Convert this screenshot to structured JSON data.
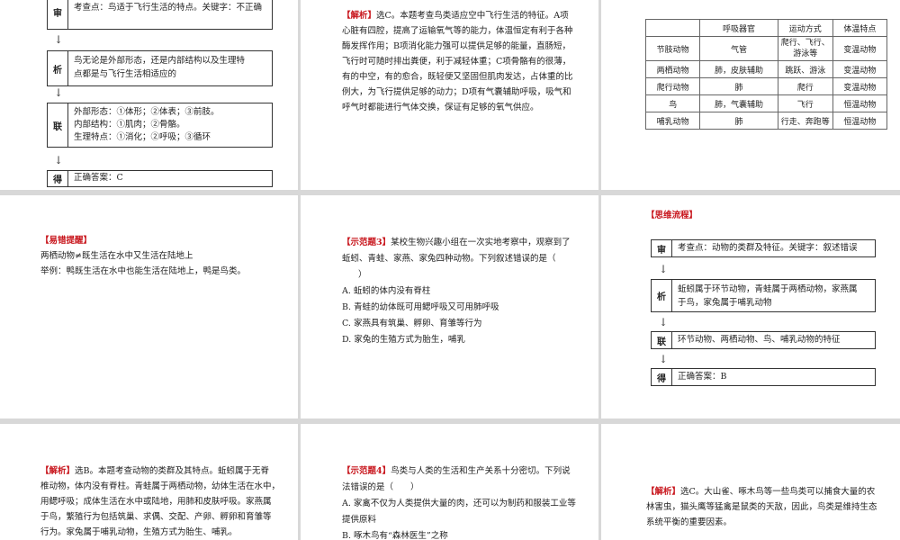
{
  "slide1": {
    "top_row": {
      "tag": "审",
      "text": "考查点：鸟适于飞行生活的特点。关键字：不正确"
    },
    "row2": {
      "tag": "析",
      "lines": [
        "鸟无论是外部形态，还是内部结构以及生理特",
        "点都是与飞行生活相适应的"
      ]
    },
    "row3": {
      "tag": "联",
      "lines": [
        "外部形态：①体形；②体表；③前肢。",
        "内部结构：①肌肉；②骨骼。",
        "生理特点：①消化；②呼吸；③循环"
      ]
    },
    "row4": {
      "tag": "得",
      "text": "正确答案：C"
    },
    "arrow_glyph": "↓"
  },
  "slide2": {
    "label": "【解析】",
    "lines": [
      "选C。本题考查鸟类适应空中飞行生活的特征。A项",
      "心脏有四腔，提高了运输氧气等的能力，体温恒定有利于各种",
      "酶发挥作用；B项消化能力强可以提供足够的能量，直肠短，",
      "飞行时可随时排出粪便，利于减轻体重；C项骨骼有的很薄，",
      "有的中空，有的愈合，既轻便又坚固但肌肉发达，占体重的比",
      "例大，为飞行提供足够的动力；D项有气囊辅助呼吸，吸气和",
      "呼气时都能进行气体交换，保证有足够的氧气供应。"
    ]
  },
  "slide3": {
    "headers": [
      "",
      "呼吸器官",
      "运动方式",
      "体温特点"
    ],
    "rows": [
      [
        "节肢动物",
        "气管",
        "爬行、飞行、游泳等",
        "变温动物"
      ],
      [
        "两栖动物",
        "肺，皮肤辅助",
        "跳跃、游泳",
        "变温动物"
      ],
      [
        "爬行动物",
        "肺",
        "爬行",
        "变温动物"
      ],
      [
        "鸟",
        "肺，气囊辅助",
        "飞行",
        "恒温动物"
      ],
      [
        "哺乳动物",
        "肺",
        "行走、奔跑等",
        "恒温动物"
      ]
    ]
  },
  "slide4": {
    "label": "【易错提醒】",
    "lines": [
      "两栖动物≠既生活在水中又生活在陆地上",
      "举例：鸭既生活在水中也能生活在陆地上，鸭是鸟类。"
    ]
  },
  "slide5": {
    "label": "【示范题3】",
    "stem": [
      "某校生物兴趣小组在一次实地考察中，观察到了",
      "蚯蚓、青蛙、家燕、家兔四种动物。下列叙述错误的是（",
      "）"
    ],
    "options": [
      "A. 蚯蚓的体内没有脊柱",
      "B. 青蛙的幼体既可用鳃呼吸又可用肺呼吸",
      "C. 家燕具有筑巢、孵卵、育雏等行为",
      "D. 家兔的生殖方式为胎生，哺乳"
    ]
  },
  "slide6": {
    "label": "【思维流程】",
    "row1": {
      "tag": "审",
      "text": "考查点：动物的类群及特征。关键字：叙述错误"
    },
    "row2": {
      "tag": "析",
      "lines": [
        "蚯蚓属于环节动物，青蛙属于两栖动物，家燕属",
        "于鸟，家兔属于哺乳动物"
      ]
    },
    "row3": {
      "tag": "联",
      "text": "环节动物、两栖动物、鸟、哺乳动物的特征"
    },
    "row4": {
      "tag": "得",
      "text": "正确答案：B"
    },
    "arrow_glyph": "↓"
  },
  "slide7": {
    "label": "【解析】",
    "lines": [
      "选B。本题考查动物的类群及其特点。蚯蚓属于无脊",
      "椎动物，体内没有脊柱。青蛙属于两栖动物，幼体生活在水中，",
      "用鳃呼吸；成体生活在水中或陆地，用肺和皮肤呼吸。家燕属",
      "于鸟，繁殖行为包括筑巢、求偶、交配、产卵、孵卵和育雏等",
      "行为。家兔属于哺乳动物，生殖方式为胎生、哺乳。"
    ]
  },
  "slide8": {
    "label": "【示范题4】",
    "stem": [
      "鸟类与人类的生活和生产关系十分密切。下列说",
      "法错误的是（　　）"
    ],
    "options": [
      "A. 家禽不仅为人类提供大量的肉，还可以为制药和服装工业等",
      "提供原料",
      "B. 啄木鸟有“森林医生”之称"
    ]
  },
  "slide9": {
    "label": "【解析】",
    "lines": [
      "选C。大山雀、啄木鸟等一些鸟类可以捕食大量的农",
      "林害虫，猫头鹰等猛禽是鼠类的天敌，因此，鸟类是维持生态",
      "系统平衡的重要因素。"
    ]
  }
}
